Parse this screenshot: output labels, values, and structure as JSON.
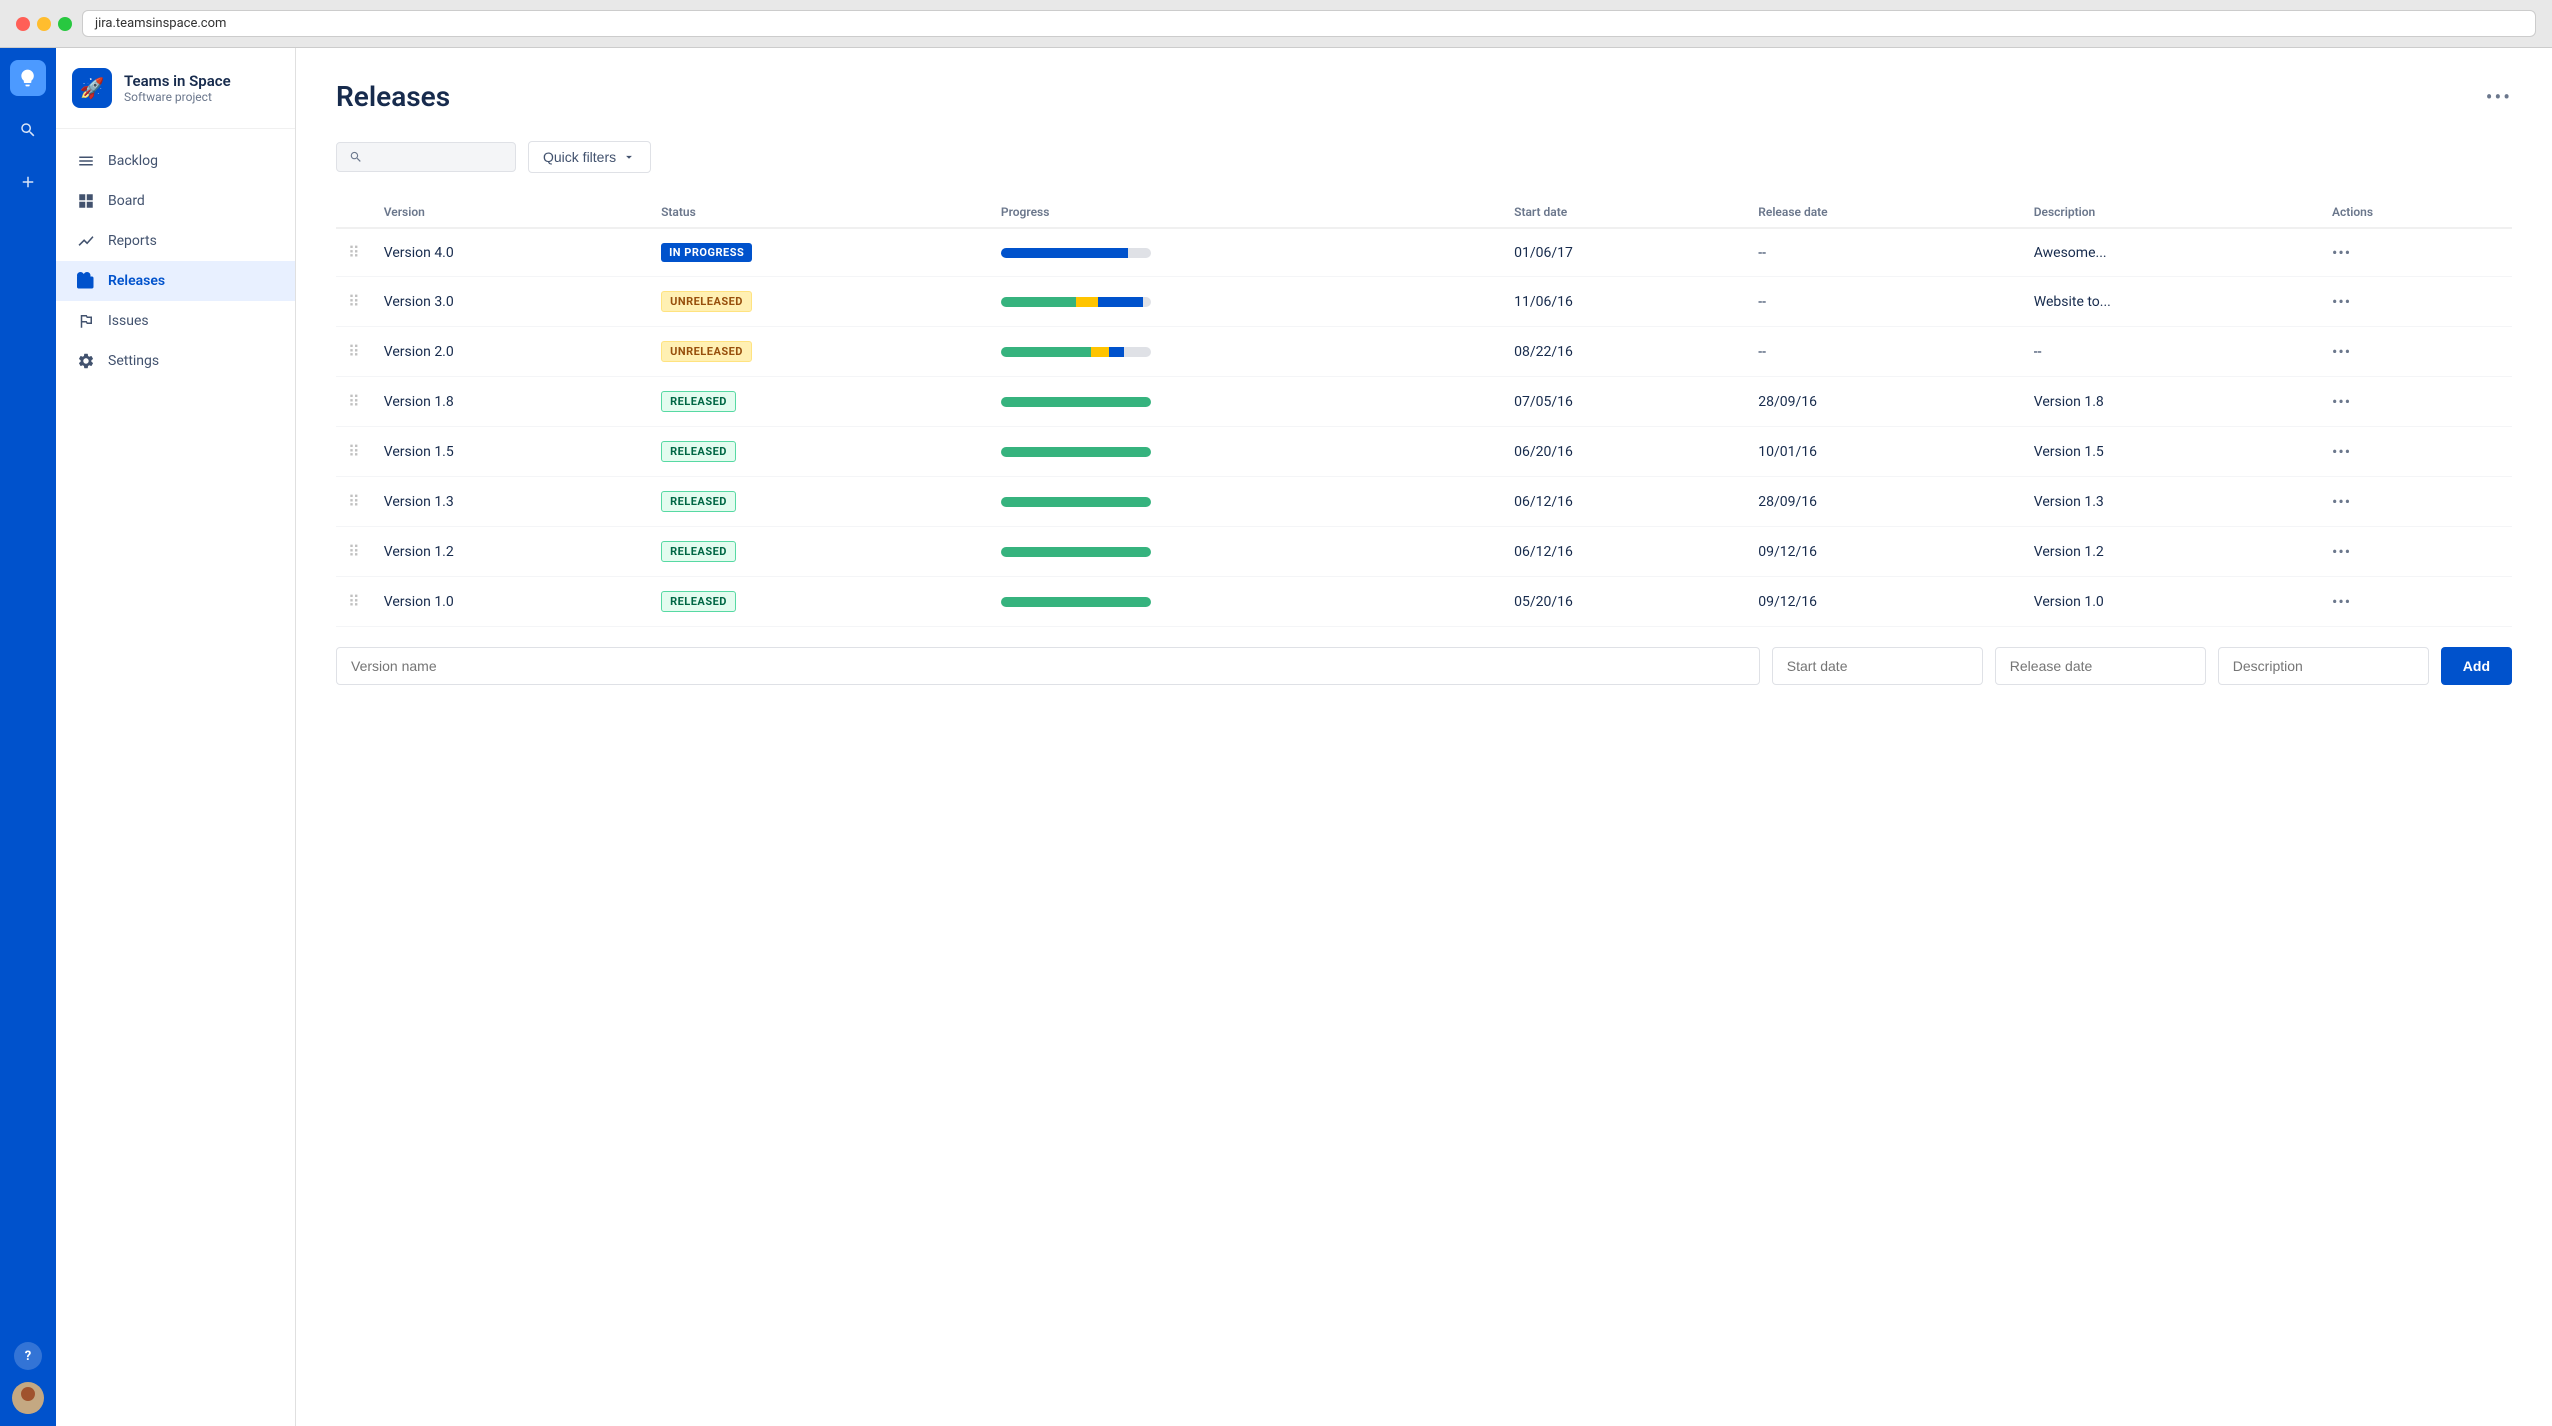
{
  "browser": {
    "url": "jira.teamsinspace.com"
  },
  "sidebar": {
    "project_name": "Teams in Space",
    "project_sub": "Software project",
    "project_emoji": "🚀",
    "nav_items": [
      {
        "id": "backlog",
        "label": "Backlog",
        "active": false
      },
      {
        "id": "board",
        "label": "Board",
        "active": false
      },
      {
        "id": "reports",
        "label": "Reports",
        "active": false
      },
      {
        "id": "releases",
        "label": "Releases",
        "active": true
      },
      {
        "id": "issues",
        "label": "Issues",
        "active": false
      },
      {
        "id": "settings",
        "label": "Settings",
        "active": false
      }
    ]
  },
  "page": {
    "title": "Releases",
    "quick_filters_label": "Quick filters"
  },
  "table": {
    "columns": [
      "Version",
      "Status",
      "Progress",
      "Start date",
      "Release date",
      "Description",
      "Actions"
    ],
    "rows": [
      {
        "version": "Version 4.0",
        "status": "IN PROGRESS",
        "status_type": "inprogress",
        "progress": {
          "green": 0,
          "yellow": 0,
          "blue": 85,
          "gray": 15
        },
        "start_date": "01/06/17",
        "release_date": "--",
        "description": "Awesome..."
      },
      {
        "version": "Version 3.0",
        "status": "UNRELEASED",
        "status_type": "unreleased",
        "progress": {
          "green": 50,
          "yellow": 15,
          "blue": 30,
          "gray": 5
        },
        "start_date": "11/06/16",
        "release_date": "--",
        "description": "Website to..."
      },
      {
        "version": "Version 2.0",
        "status": "UNRELEASED",
        "status_type": "unreleased",
        "progress": {
          "green": 60,
          "yellow": 12,
          "blue": 10,
          "gray": 18
        },
        "start_date": "08/22/16",
        "release_date": "--",
        "description": "--"
      },
      {
        "version": "Version 1.8",
        "status": "RELEASED",
        "status_type": "released",
        "progress": {
          "green": 100,
          "yellow": 0,
          "blue": 0,
          "gray": 0
        },
        "start_date": "07/05/16",
        "release_date": "28/09/16",
        "description": "Version 1.8"
      },
      {
        "version": "Version 1.5",
        "status": "RELEASED",
        "status_type": "released",
        "progress": {
          "green": 100,
          "yellow": 0,
          "blue": 0,
          "gray": 0
        },
        "start_date": "06/20/16",
        "release_date": "10/01/16",
        "description": "Version 1.5"
      },
      {
        "version": "Version 1.3",
        "status": "RELEASED",
        "status_type": "released",
        "progress": {
          "green": 100,
          "yellow": 0,
          "blue": 0,
          "gray": 0
        },
        "start_date": "06/12/16",
        "release_date": "28/09/16",
        "description": "Version 1.3"
      },
      {
        "version": "Version 1.2",
        "status": "RELEASED",
        "status_type": "released",
        "progress": {
          "green": 100,
          "yellow": 0,
          "blue": 0,
          "gray": 0
        },
        "start_date": "06/12/16",
        "release_date": "09/12/16",
        "description": "Version 1.2"
      },
      {
        "version": "Version 1.0",
        "status": "RELEASED",
        "status_type": "released",
        "progress": {
          "green": 100,
          "yellow": 0,
          "blue": 0,
          "gray": 0
        },
        "start_date": "05/20/16",
        "release_date": "09/12/16",
        "description": "Version 1.0"
      }
    ]
  },
  "add_form": {
    "version_placeholder": "Version name",
    "start_date_placeholder": "Start date",
    "release_date_placeholder": "Release date",
    "description_placeholder": "Description",
    "button_label": "Add"
  }
}
